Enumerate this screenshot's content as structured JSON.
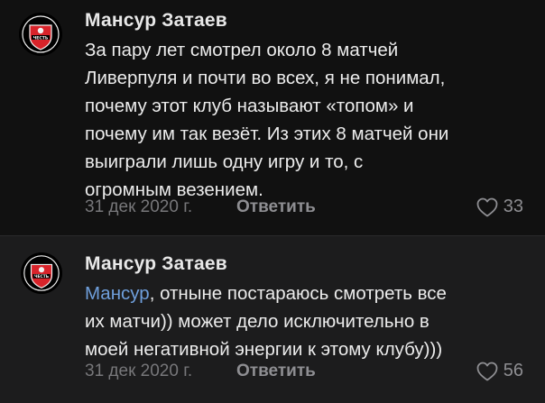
{
  "comments": [
    {
      "author": "Мансур Затаев",
      "avatar": {
        "name": "fc-crest-avatar",
        "crest_text": "ЧЕСТЬ",
        "colors": {
          "bg": "#000000",
          "crest": "#d8232a",
          "trim": "#f1f1f1"
        }
      },
      "text_lines": [
        "За пару лет смотрел около 8 матчей",
        "Ливерпуля и почти во всех, я не понимал,",
        "почему этот клуб называют «топом» и",
        "почему им так везёт. Из этих 8 матчей они",
        "выиграли лишь одну игру и то, с",
        "огромным везением."
      ],
      "date": "31 дек 2020 г.",
      "reply_label": "Ответить",
      "likes": "33"
    },
    {
      "author": "Мансур Затаев",
      "avatar": {
        "name": "fc-crest-avatar",
        "crest_text": "ЧЕСТЬ",
        "colors": {
          "bg": "#000000",
          "crest": "#d8232a",
          "trim": "#f1f1f1"
        }
      },
      "mention": "Мансур",
      "text_first_rest": ", отныне постараюсь смотреть все",
      "text_lines": [
        "их матчи)) может дело исключительно в",
        "моей негативной энергии к этому клубу)))"
      ],
      "date": "31 дек 2020 г.",
      "reply_label": "Ответить",
      "likes": "56"
    }
  ],
  "colors": {
    "background": "#111111",
    "highlighted_background": "#1c1c1d",
    "text": "#ececec",
    "muted": "#77777a",
    "mention": "#6f9fdc"
  }
}
